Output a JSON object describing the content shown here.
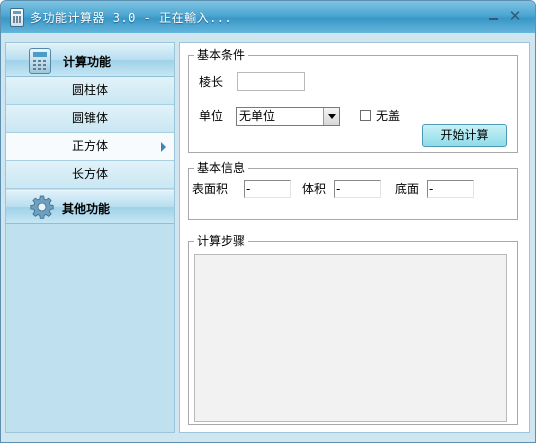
{
  "window": {
    "title": "多功能计算器 3.0 - 正在輸入..."
  },
  "sidebar": {
    "calc_header": "计算功能",
    "items": [
      {
        "label": "圆柱体"
      },
      {
        "label": "圆锥体"
      },
      {
        "label": "正方体",
        "selected": true
      },
      {
        "label": "长方体"
      }
    ],
    "other_header": "其他功能"
  },
  "basic_conditions": {
    "title": "基本条件",
    "edge_label": "棱长",
    "edge_value": "",
    "unit_label": "单位",
    "unit_selected": "无单位",
    "no_lid_label": "无盖",
    "no_lid_checked": false,
    "start_button": "开始计算"
  },
  "basic_info": {
    "title": "基本信息",
    "surface_label": "表面积",
    "surface_value": "-",
    "volume_label": "体积",
    "volume_value": "-",
    "base_label": "底面",
    "base_value": "-"
  },
  "steps": {
    "title": "计算步骤",
    "content": ""
  },
  "colors": {
    "titlebar": "#4ca6d1",
    "sidebar": "#bfe0ee",
    "button": "#a6e4ef"
  },
  "icons": {
    "app": "calculator-icon",
    "calc_header": "calculator-icon",
    "other_header": "gear-icon"
  }
}
